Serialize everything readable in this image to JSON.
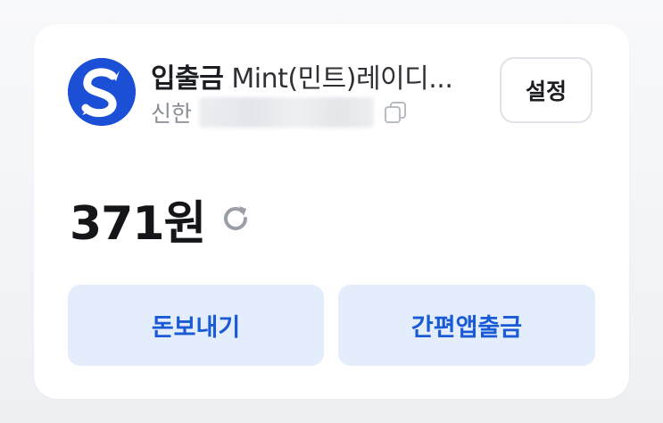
{
  "account": {
    "title_bold": "입출금",
    "title_name": " Mint(민트)레이디...",
    "bank": "신한",
    "number_masked": ""
  },
  "settings_label": "설정",
  "balance": "371원",
  "actions": {
    "send_label": "돈보내기",
    "withdraw_label": "간편앱출금"
  },
  "colors": {
    "brand": "#1a4fd6",
    "button_bg": "#e3edfb",
    "button_text": "#1a5ad6"
  },
  "icons": {
    "bank_logo": "shinhan-logo-icon",
    "copy": "copy-icon",
    "refresh": "refresh-icon"
  }
}
